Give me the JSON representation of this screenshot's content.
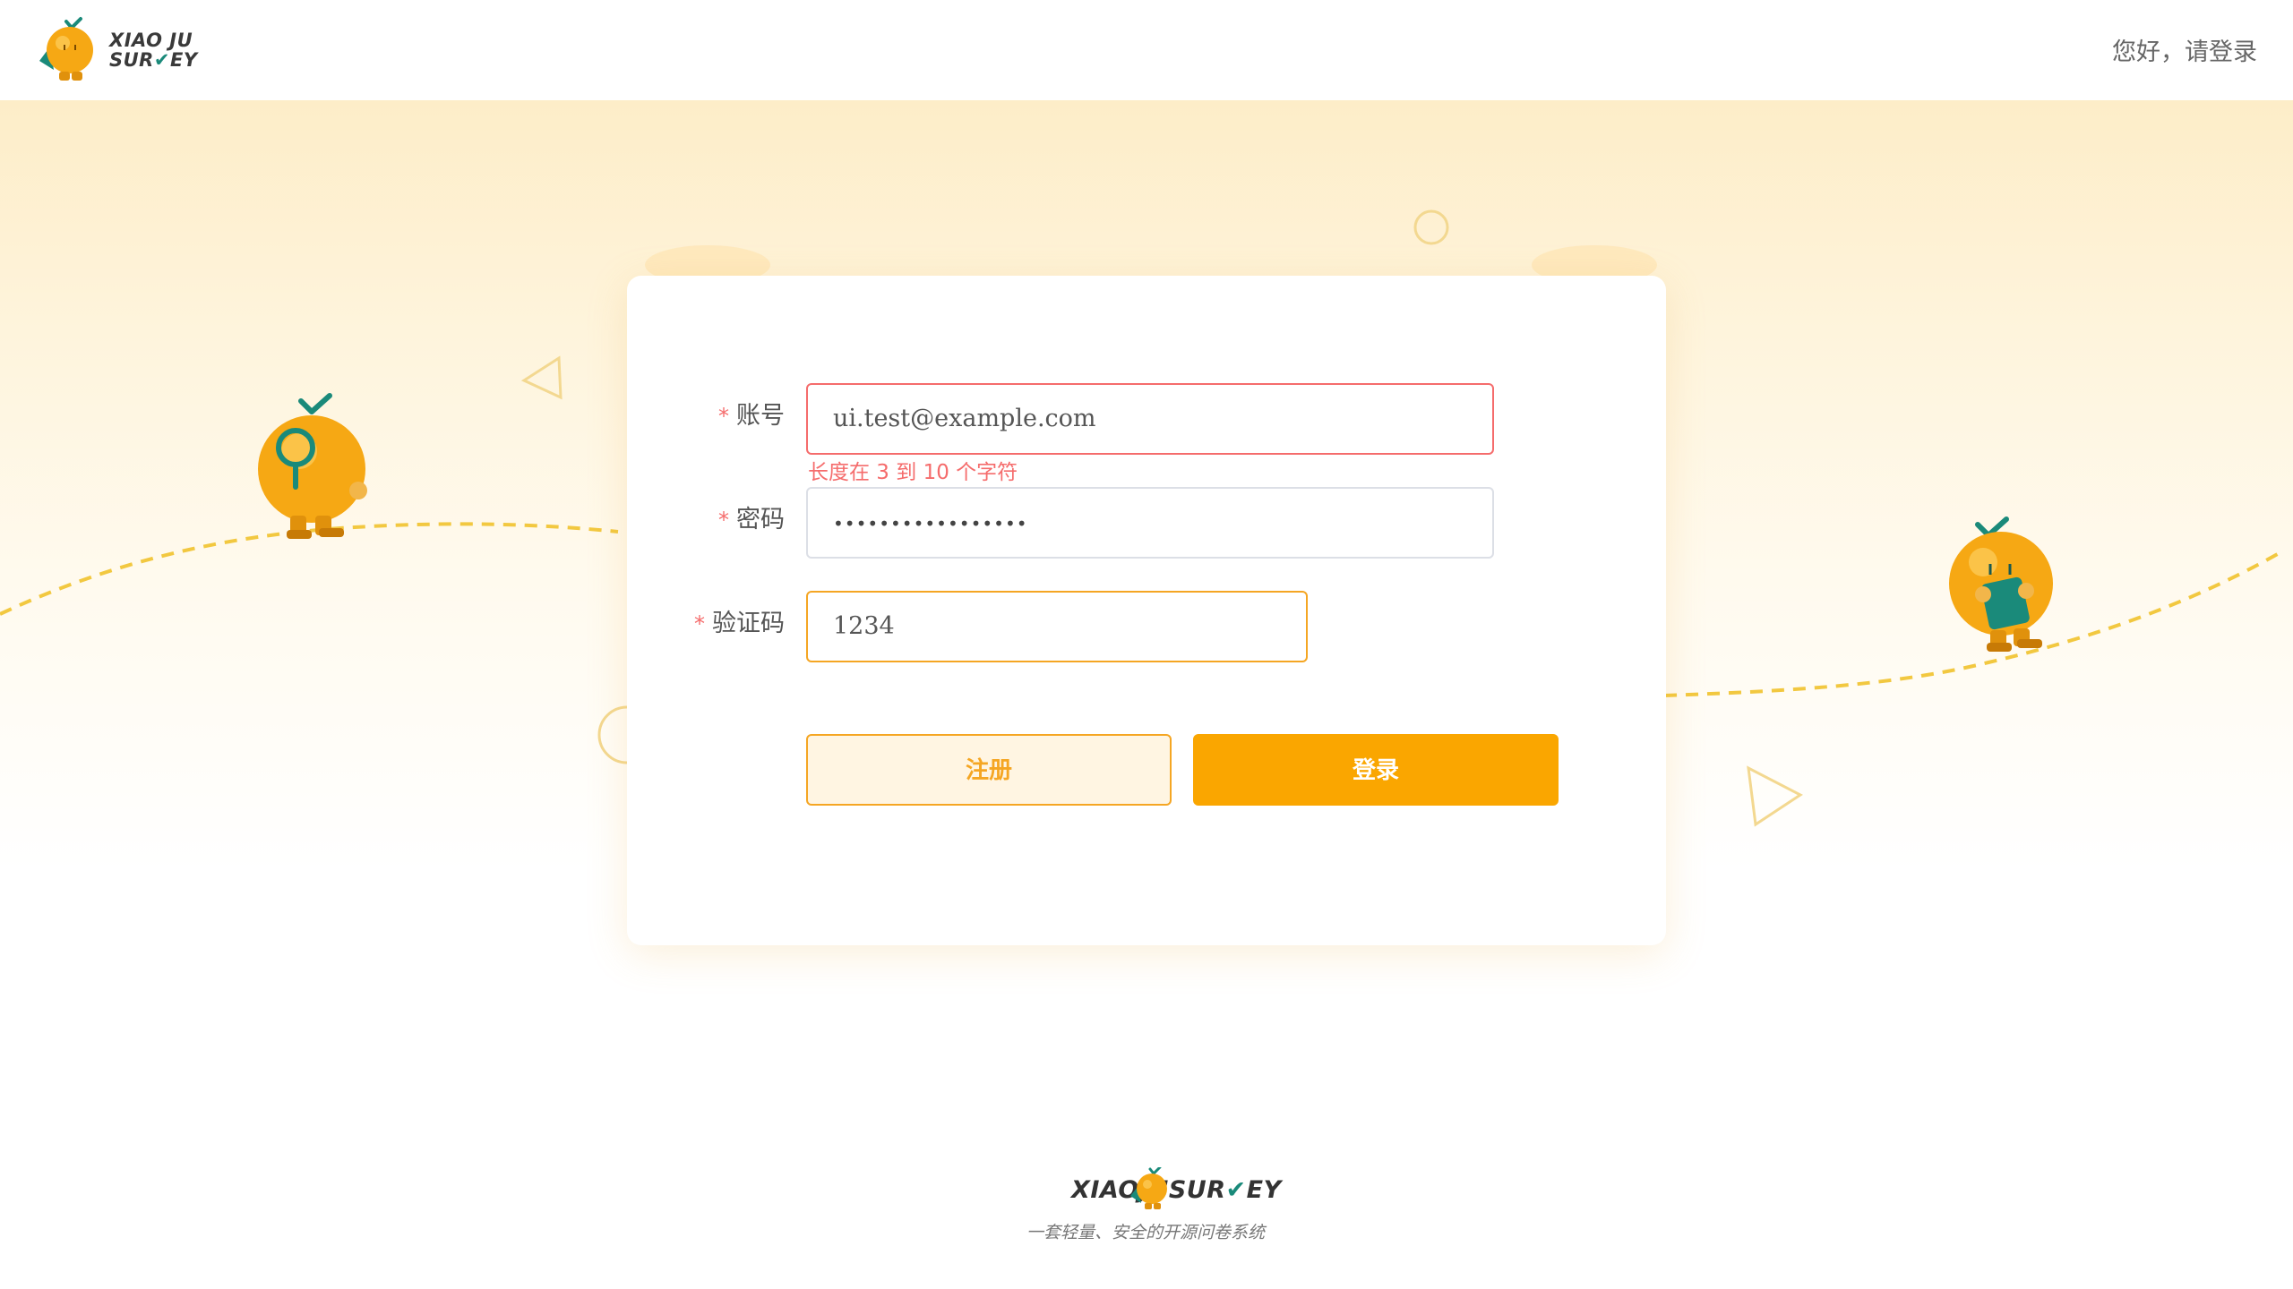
{
  "header": {
    "logo_line1": "XIAO JU",
    "logo_line2_a": "SUR",
    "logo_line2_check": "✔",
    "logo_line2_b": "EY",
    "greeting": "您好，请登录"
  },
  "form": {
    "account": {
      "label": "账号",
      "value": "ui.test@example.com",
      "error": "长度在 3 到 10 个字符"
    },
    "password": {
      "label": "密码",
      "value": "•••••••••••••••••"
    },
    "captcha": {
      "label": "验证码",
      "value": "1234"
    },
    "required_mark": "*",
    "register_label": "注册",
    "login_label": "登录"
  },
  "footer": {
    "brand_a": "XIAOJUSUR",
    "brand_check": "✔",
    "brand_b": "EY",
    "slogan": "一套轻量、安全的开源问卷系统"
  },
  "colors": {
    "accent": "#faa600",
    "error": "#f56c6c",
    "brand_check": "#1a8a7a"
  },
  "icons": [
    "orange-mascot-logo-icon",
    "magnifier-mascot-icon",
    "book-mascot-icon",
    "triangle-deco-icon",
    "circle-deco-icon"
  ]
}
